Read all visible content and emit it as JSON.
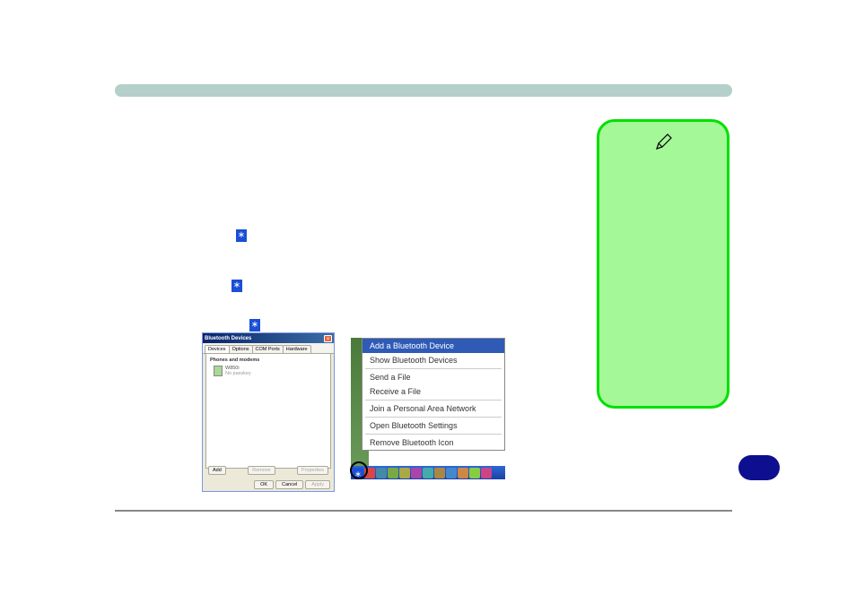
{
  "header_bar": "",
  "bluetooth_icon_label": "bluetooth",
  "dialog": {
    "title": "Bluetooth Devices",
    "close": "×",
    "tabs": [
      {
        "label": "Devices"
      },
      {
        "label": "Options"
      },
      {
        "label": "COM Ports"
      },
      {
        "label": "Hardware"
      }
    ],
    "section_label": "Phones and modems",
    "device": {
      "name": "W850i",
      "sub": "No passkey"
    },
    "btn_add": "Add",
    "btn_remove": "Remove",
    "btn_properties": "Properties",
    "btn_ok": "OK",
    "btn_cancel": "Cancel",
    "btn_apply": "Apply"
  },
  "context_menu": {
    "items": [
      {
        "label": "Add a Bluetooth Device",
        "highlighted": true
      },
      {
        "label": "Show Bluetooth Devices"
      },
      {
        "label": "Send a File"
      },
      {
        "label": "Receive a File"
      },
      {
        "label": "Join a Personal Area Network"
      },
      {
        "label": "Open Bluetooth Settings"
      },
      {
        "label": "Remove Bluetooth Icon"
      }
    ]
  }
}
